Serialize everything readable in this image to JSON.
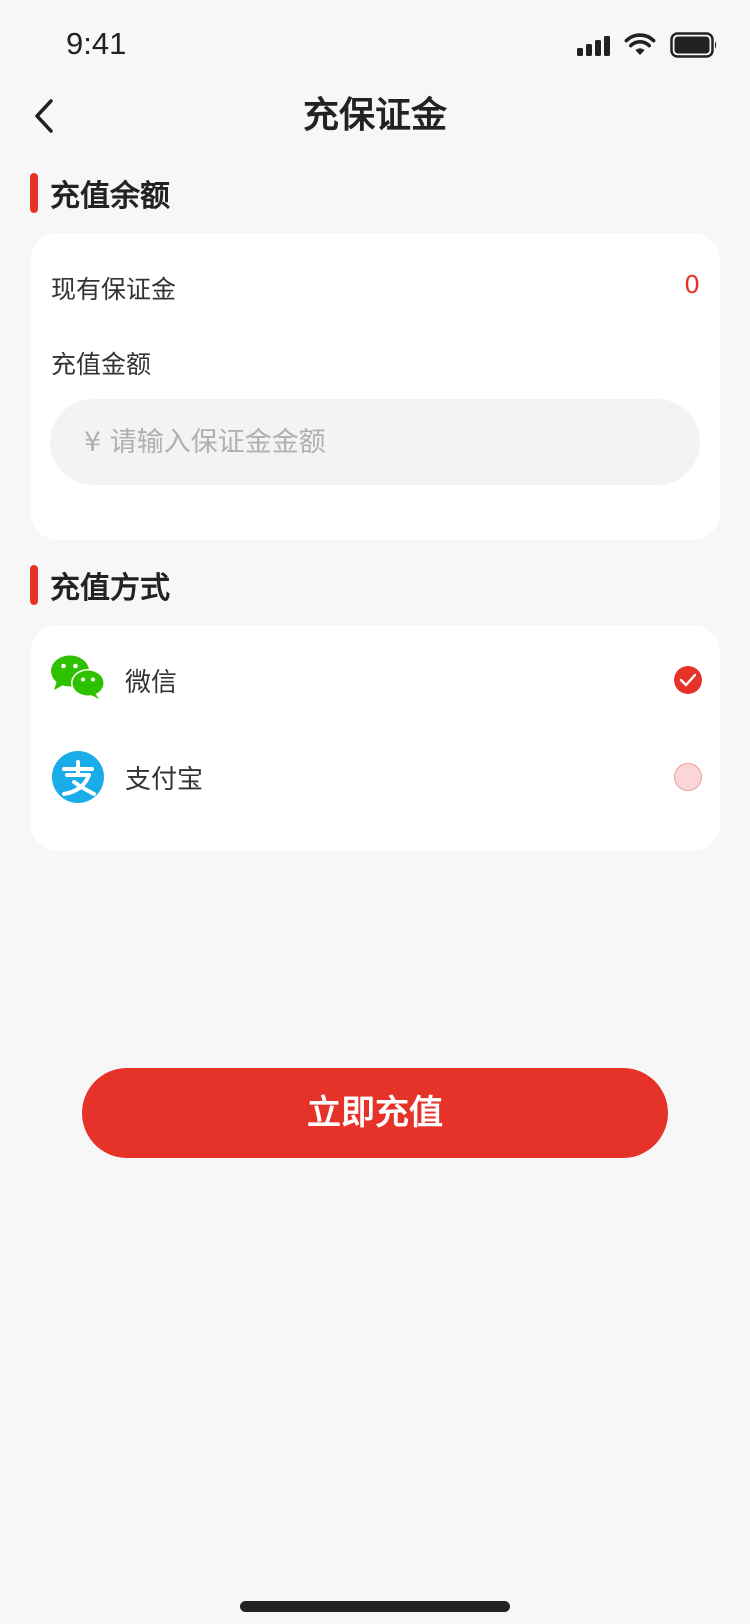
{
  "status_bar": {
    "time": "9:41"
  },
  "header": {
    "title": "充保证金"
  },
  "balance_section": {
    "title": "充值余额",
    "current_deposit_label": "现有保证金",
    "current_deposit_value": "0",
    "amount_label": "充值金额",
    "amount_placeholder": "¥ 请输入保证金金额",
    "amount_value": ""
  },
  "payment_section": {
    "title": "充值方式",
    "methods": [
      {
        "label": "微信",
        "icon": "wechat-icon",
        "selected": true
      },
      {
        "label": "支付宝",
        "icon": "alipay-icon",
        "selected": false
      }
    ]
  },
  "submit_label": "立即充值",
  "colors": {
    "accent": "#e5332a",
    "wechat": "#2dc100",
    "alipay": "#1aabe9"
  }
}
